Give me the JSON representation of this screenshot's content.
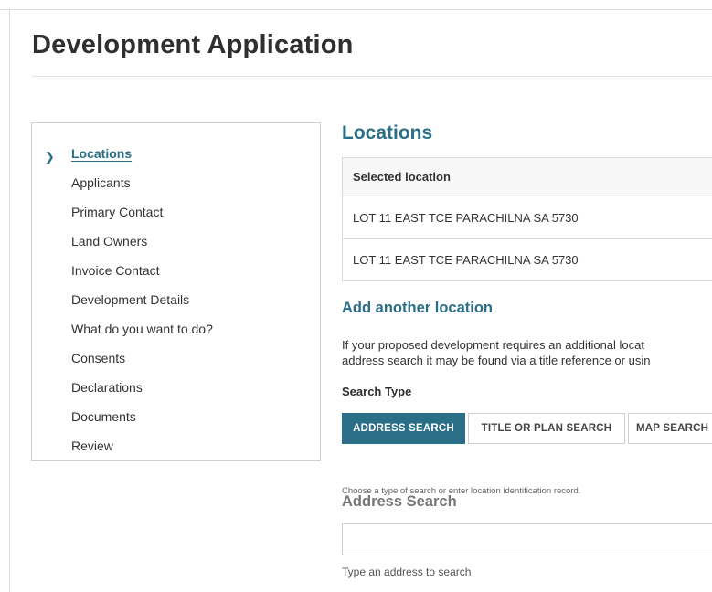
{
  "page": {
    "title": "Development Application"
  },
  "sidebar": {
    "items": [
      {
        "label": "Locations",
        "active": true
      },
      {
        "label": "Applicants"
      },
      {
        "label": "Primary Contact"
      },
      {
        "label": "Land Owners"
      },
      {
        "label": "Invoice Contact"
      },
      {
        "label": "Development Details"
      },
      {
        "label": "What do you want to do?"
      },
      {
        "label": "Consents"
      },
      {
        "label": "Declarations"
      },
      {
        "label": "Documents"
      },
      {
        "label": "Review"
      }
    ]
  },
  "locations": {
    "heading": "Locations",
    "table_header": "Selected location",
    "rows": [
      "LOT 11 EAST TCE PARACHILNA SA 5730",
      "LOT 11 EAST TCE PARACHILNA SA 5730"
    ]
  },
  "add_location": {
    "heading": "Add another location",
    "paragraph_line1": "If your proposed development requires an additional locat",
    "paragraph_line2": "address search it may be found via a title reference or usin",
    "search_type_label": "Search Type",
    "buttons": {
      "address": "ADDRESS SEARCH",
      "title_plan": "TITLE OR PLAN SEARCH",
      "map": "MAP SEARCH"
    },
    "hint": "Choose a type of search or enter location identification record."
  },
  "address_search": {
    "heading": "Address Search",
    "value": "",
    "help": "Type an address to search"
  },
  "colors": {
    "accent": "#2a6f87",
    "border": "#cfcfcf"
  }
}
